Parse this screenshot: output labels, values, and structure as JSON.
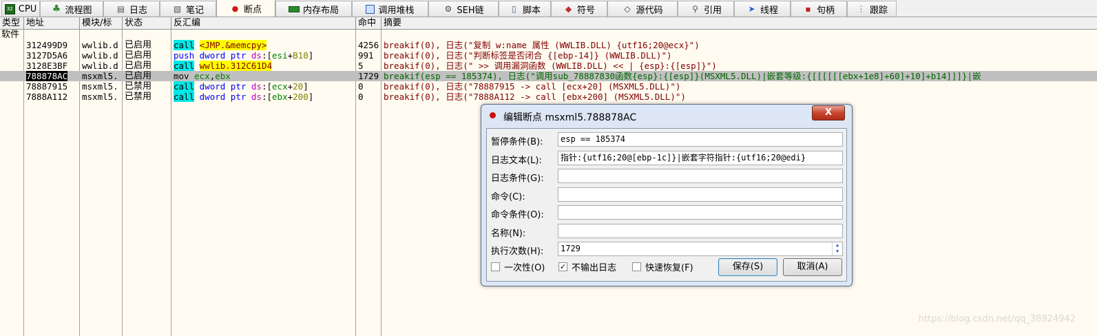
{
  "tabs": [
    {
      "label": "CPU",
      "icon": "cpu-icon",
      "w": 56
    },
    {
      "label": "流程图",
      "icon": "tree-icon",
      "w": 92
    },
    {
      "label": "日志",
      "icon": "log-icon",
      "w": 82
    },
    {
      "label": "笔记",
      "icon": "notes-icon",
      "w": 82
    },
    {
      "label": "断点",
      "icon": "breakpoint-icon",
      "w": 86,
      "active": true
    },
    {
      "label": "内存布局",
      "icon": "memory-map-icon",
      "w": 111
    },
    {
      "label": "调用堆栈",
      "icon": "call-stack-icon",
      "w": 111
    },
    {
      "label": "SEH链",
      "icon": "seh-chain-icon",
      "w": 102
    },
    {
      "label": "脚本",
      "icon": "script-icon",
      "w": 76
    },
    {
      "label": "符号",
      "icon": "symbol-icon",
      "w": 82
    },
    {
      "label": "源代码",
      "icon": "source-icon",
      "w": 102
    },
    {
      "label": "引用",
      "icon": "reference-icon",
      "w": 82
    },
    {
      "label": "线程",
      "icon": "thread-icon",
      "w": 82
    },
    {
      "label": "句柄",
      "icon": "handle-icon",
      "w": 82
    },
    {
      "label": "跟踪",
      "icon": "trace-icon",
      "w": 72
    }
  ],
  "columns": {
    "type": "类型",
    "address": "地址",
    "module": "模块/标",
    "status": "状态",
    "disasm": "反汇编",
    "hits": "命中",
    "summary": "摘要"
  },
  "group_label": "软件",
  "rows": [
    {
      "address": "312499D9",
      "module": "wwlib.d",
      "status": "已启用",
      "disasm": "call <JMP.&memcpy>",
      "hits": "4256",
      "summary": "breakif(0), 日志(\"复制 w:name 属性 (WWLIB.DLL) {utf16;20@ecx}\")"
    },
    {
      "address": "3127D5A6",
      "module": "wwlib.d",
      "status": "已启用",
      "disasm": "push dword ptr ds:[esi+B10]",
      "hits": "991",
      "summary": "breakif(0), 日志(\"判断标签是否闭合 {[ebp-14]} (WWLIB.DLL)\")"
    },
    {
      "address": "3128E3BF",
      "module": "wwlib.d",
      "status": "已启用",
      "disasm": "call wwlib.312C61D4",
      "hits": "5",
      "summary": "breakif(0), 日志(\" >> 调用漏洞函数 (WWLIB.DLL) << | {esp}:{[esp]}\")"
    },
    {
      "address": "788878AC",
      "module": "msxml5.",
      "status": "已启用",
      "disasm": "mov ecx,ebx",
      "hits": "1729",
      "summary": "breakif(esp == 185374), 日志(\"调用sub_78887830函数{esp}:{[esp]}(MSXML5.DLL)|嵌套等级:{[[[[[[ebx+1e8]+60]+10]+b14]]]}|嵌"
    },
    {
      "address": "78887915",
      "module": "msxml5.",
      "status": "已禁用",
      "disasm": "call dword ptr ds:[ecx+20]",
      "hits": "0",
      "summary": "breakif(0), 日志(\"78887915 -> call [ecx+20] (MSXML5.DLL)\")"
    },
    {
      "address": "7888A112",
      "module": "msxml5.",
      "status": "已禁用",
      "disasm": "call dword ptr ds:[ebx+200]",
      "hits": "0",
      "summary": "breakif(0), 日志(\"7888A112 -> call [ebx+200] (MSXML5.DLL)\")"
    }
  ],
  "dialog": {
    "title": "编辑断点 msxml5.788878AC",
    "close": "X",
    "fields": [
      {
        "label": "暂停条件(B):",
        "value": "esp == 185374"
      },
      {
        "label": "日志文本(L):",
        "value": "指针:{utf16;20@[ebp-1c]}|嵌套字符指针:{utf16;20@edi}"
      },
      {
        "label": "日志条件(G):",
        "value": ""
      },
      {
        "label": "命令(C):",
        "value": ""
      },
      {
        "label": "命令条件(O):",
        "value": ""
      },
      {
        "label": "名称(N):",
        "value": ""
      },
      {
        "label": "执行次数(H):",
        "value": "1729"
      }
    ],
    "checkboxes": [
      {
        "label": "一次性(O)",
        "checked": false
      },
      {
        "label": "不输出日志",
        "checked": true
      },
      {
        "label": "快速恢复(F)",
        "checked": false
      }
    ],
    "save": "保存(S)",
    "cancel": "取消(A)"
  },
  "watermark": "https://blog.csdn.net/qq_38924942"
}
